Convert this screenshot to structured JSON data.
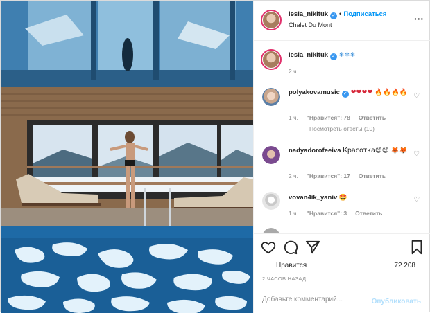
{
  "header": {
    "username": "lesia_nikituk",
    "verified_symbol": "✓",
    "separator": "•",
    "follow_label": "Подписаться",
    "location": "Chalet Du Mont",
    "more_label": "···"
  },
  "caption": {
    "username": "lesia_nikituk",
    "verified_symbol": "✓",
    "text": "❄❄❄",
    "time": "2 ч."
  },
  "comments": [
    {
      "username": "polyakovamusic",
      "verified": true,
      "text": "❤❤❤❤ 🔥🔥🔥🔥",
      "time": "1 ч.",
      "likes": "\"Нравится\": 78",
      "reply": "Ответить",
      "view_replies": "Посмотреть ответы (10)"
    },
    {
      "username": "nadyadorofeeiva",
      "verified": false,
      "text": "Красотка😊😊 🦊🦊",
      "time": "2 ч.",
      "likes": "\"Нравится\": 17",
      "reply": "Ответить"
    },
    {
      "username": "vovan4ik_yaniv",
      "verified": false,
      "text": "🤩",
      "time": "1 ч.",
      "likes": "\"Нравится\": 3",
      "reply": "Ответить"
    }
  ],
  "actions": {
    "like_icon": "heart-icon",
    "comment_icon": "comment-icon",
    "share_icon": "paper-plane-icon",
    "save_icon": "bookmark-icon",
    "likes_label": "Нравится",
    "likes_count": "72 208",
    "timestamp": "2 ЧАСОВ НАЗАД"
  },
  "add_comment": {
    "placeholder": "Добавьте комментарий...",
    "publish_label": "Опубликовать"
  },
  "colors": {
    "accent": "#0095f6",
    "verified": "#3897f0",
    "muted": "#8e8e8e",
    "pool": "#2c6f9d"
  }
}
